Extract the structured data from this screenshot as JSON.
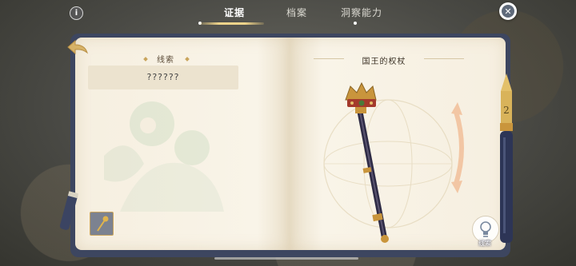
{
  "tabs": [
    {
      "label": "证据",
      "active": true
    },
    {
      "label": "档案",
      "active": false
    },
    {
      "label": "洞察能力",
      "active": false
    }
  ],
  "info_icon": "info-icon",
  "close_icon": "close-icon",
  "back_icon": "back-arrow-icon",
  "left_page": {
    "title": "线索",
    "clue_text": "??????"
  },
  "right_page": {
    "item_name": "国王的权杖"
  },
  "hint_button": {
    "label": "线索",
    "icon": "lightbulb-icon"
  },
  "colors": {
    "accent_gold": "#c9a45c",
    "book_cover": "#3d4660",
    "page": "#f7f1e3"
  }
}
